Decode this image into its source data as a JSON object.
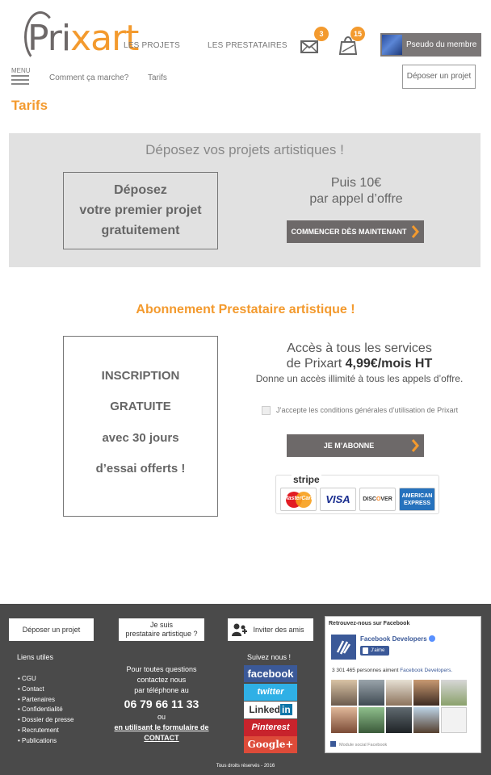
{
  "header": {
    "logo": {
      "part1": "Pri",
      "part2": "xart"
    },
    "nav": {
      "projects": "LES PROJETS",
      "providers": "LES PRESTATAIRES"
    },
    "messages_badge": "3",
    "notifications_badge": "15",
    "member_name": "Pseudo du membre",
    "menu_label": "MENU",
    "sub_nav": {
      "how": "Comment ça marche?",
      "pricing": "Tarifs"
    },
    "post_project_button": "Déposer un projet"
  },
  "page_title": "Tarifs",
  "deposit_panel": {
    "title": "Déposez vos projets artistiques !",
    "free_lines": [
      "Déposez",
      "votre premier projet",
      "gratuitement"
    ],
    "then_lines": [
      "Puis 10€",
      "par appel d’offre"
    ],
    "cta": "COMMENCER DÈS MAINTENANT"
  },
  "subscription": {
    "title": "Abonnement Prestataire artistique !",
    "box_lines": [
      "INSCRIPTION",
      "GRATUITE",
      "avec 30 jours",
      "d’essai offerts !"
    ],
    "access_line1": "Accès à tous les services",
    "access_line2_prefix": "de Prixart ",
    "access_price": "4,99€/mois HT",
    "access_line3": "Donne un accès illimité à tous les appels d’offre.",
    "terms_label": "J’accepte les conditions générales d’utilisation de Prixart",
    "subscribe_button": "JE M’ABONNE",
    "payment": {
      "provider": "stripe",
      "cards": {
        "mastercard": "MasterCard",
        "visa": "VISA",
        "discover_a": "DISC",
        "discover_b": "O",
        "discover_c": "VER",
        "amex_a": "AMERICAN",
        "amex_b": "EXPRESS"
      }
    }
  },
  "footer": {
    "buttons": {
      "post_project": "Déposer un projet",
      "provider_a": "Je suis",
      "provider_b": "prestataire artistique ?",
      "invite": "Inviter des amis"
    },
    "useful_links_title": "Liens utiles",
    "useful_links": [
      "CGU",
      "Contact",
      "Partenaires",
      "Confidentialité",
      "Dossier de presse",
      "Recrutement",
      "Publications"
    ],
    "contact": {
      "line1": "Pour toutes questions",
      "line2": "contactez nous",
      "line3": "par téléphone au",
      "phone": "06 79 66 11 33",
      "or": "ou",
      "link_a": "en utilisant le formulaire de",
      "link_b": "CONTACT"
    },
    "follow_title": "Suivez nous !",
    "social": {
      "facebook": "facebook",
      "twitter": "twitter",
      "linkedin_a": "Linked",
      "linkedin_b": "in",
      "pinterest": "Pinterest",
      "google": "Google+"
    },
    "facebook_widget": {
      "header": "Retrouvez-nous sur Facebook",
      "page_name": "Facebook Developers",
      "like_button": "J’aime",
      "count_prefix": "3 301 465 personnes aiment ",
      "count_page": "Facebook Developers.",
      "module_label": "Module social Facebook"
    },
    "copyright": "Tous droits réservés - 2016"
  },
  "colors": {
    "accent": "#f39a2e",
    "dark_button": "#6d6969",
    "footer_bg": "#4a4a4a",
    "panel_bg": "#e1e1e1"
  }
}
